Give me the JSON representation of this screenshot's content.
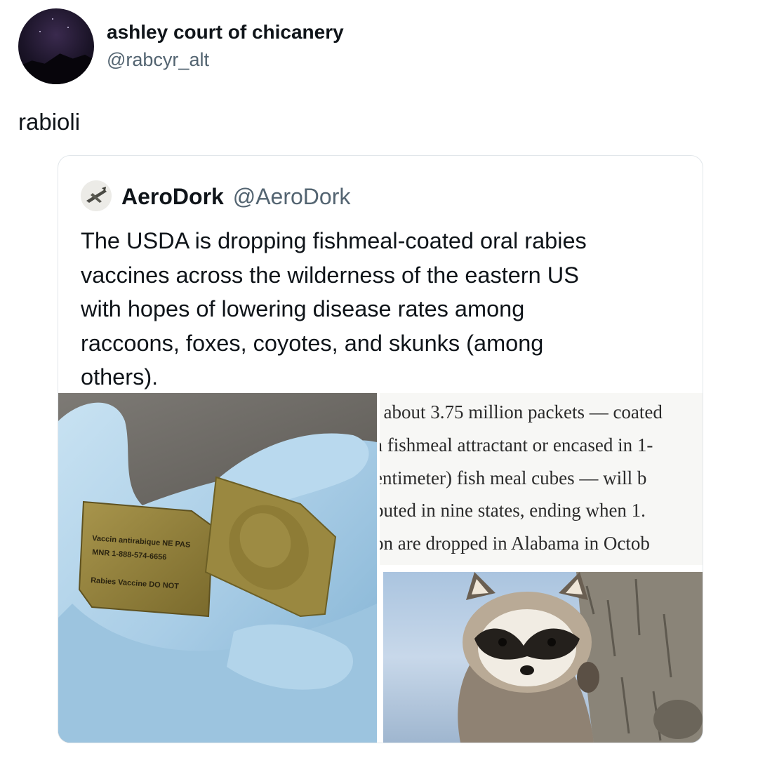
{
  "tweet": {
    "display_name": "ashley court of chicanery",
    "handle": "@rabcyr_alt",
    "text": "rabioli",
    "avatar_icon": "night-mountain-avatar"
  },
  "quoted_tweet": {
    "display_name": "AeroDork",
    "handle": "@AeroDork",
    "avatar_icon": "airplane-avatar",
    "text_lines": [
      "The USDA is dropping fishmeal-coated oral rabies",
      "vaccines across the wilderness of the eastern US",
      "with hopes of lowering disease rates among",
      "raccoons, foxes, coyotes, and skunks (among",
      "others)."
    ],
    "media": {
      "left_image_icon": "gloved-hand-vaccine-packets-image",
      "packet_label_lines": [
        "Rabies Vaccine DO NOT",
        "Vaccin antirabique NE PAS",
        "MNR 1-888-574-6656"
      ],
      "article_lines": [
        ", about 3.75 million packets — coated",
        "a fishmeal attractant or encased in 1-",
        "entimeter) fish meal cubes — will b",
        "buted in nine states, ending when 1.",
        "on are dropped in Alabama in Octob"
      ],
      "right_image_icon": "raccoon-on-tree-image"
    }
  },
  "colors": {
    "text_primary": "#0f1419",
    "text_secondary": "#536471",
    "border": "#e1e6ea",
    "glove": "#a9cde6",
    "packet": "#8a7a3a"
  }
}
